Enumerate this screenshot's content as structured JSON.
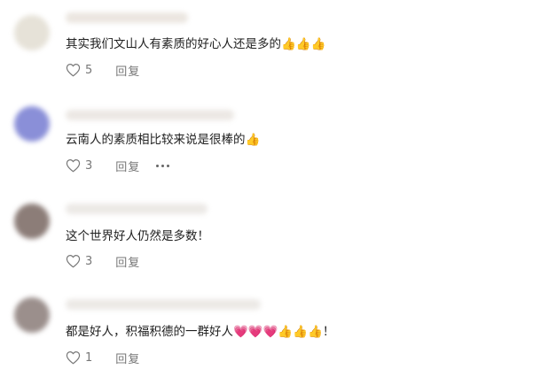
{
  "comments": [
    {
      "username": "████████",
      "text": "其实我们文山人有素质的好心人还是多的👍👍👍",
      "likes": "5",
      "reply_label": "回复",
      "avatar_color": "#e6e2d8",
      "has_more": false
    },
    {
      "username": "████████████",
      "text": "云南人的素质相比较来说是很棒的👍",
      "likes": "3",
      "reply_label": "回复",
      "avatar_color": "#8a8fd8",
      "has_more": true
    },
    {
      "username": "███████████",
      "text": "这个世界好人仍然是多数！",
      "likes": "3",
      "reply_label": "回复",
      "avatar_color": "#8c7d78",
      "has_more": false
    },
    {
      "username": "██████████████",
      "text": "都是好人，积福积德的一群好人💗💗💗👍👍👍！",
      "likes": "1",
      "reply_label": "回复",
      "avatar_color": "#9b8f8c",
      "has_more": false
    }
  ],
  "icons": {
    "like": "heart-outline-icon",
    "more": "ellipsis-icon"
  }
}
